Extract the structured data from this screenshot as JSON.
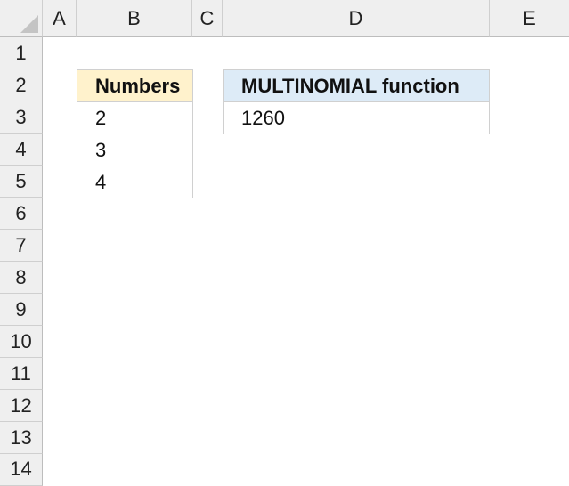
{
  "columns": [
    "A",
    "B",
    "C",
    "D",
    "E"
  ],
  "rows": [
    "1",
    "2",
    "3",
    "4",
    "5",
    "6",
    "7",
    "8",
    "9",
    "10",
    "11",
    "12",
    "13",
    "14"
  ],
  "table_numbers": {
    "header": "Numbers",
    "values": [
      "2",
      "3",
      "4"
    ]
  },
  "table_result": {
    "header": "MULTINOMIAL function",
    "value": "1260"
  },
  "colors": {
    "numbers_header_fill": "#fff2cc",
    "result_header_fill": "#ddebf7",
    "header_bg": "#efefef"
  }
}
